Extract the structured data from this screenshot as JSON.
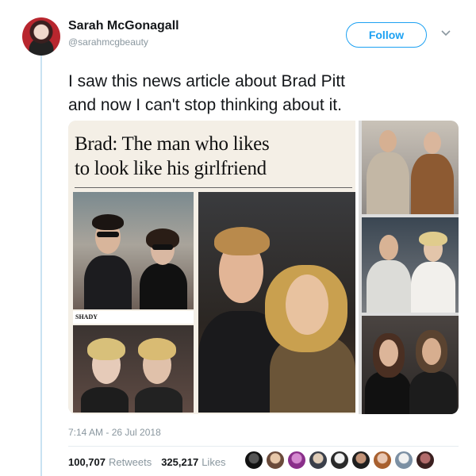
{
  "author": {
    "name": "Sarah McGonagall",
    "handle": "@sarahmcgbeauty"
  },
  "actions": {
    "follow_label": "Follow",
    "more_icon": "chevron-down-icon"
  },
  "tweet": {
    "line1": "I saw this news article about Brad Pitt",
    "line2": "and now I can't stop thinking about it."
  },
  "media": {
    "headline_line1": "Brad: The man who likes",
    "headline_line2": "to look like his girlfriend",
    "caption": "SHADY"
  },
  "meta": {
    "timestamp": "7:14 AM - 26 Jul 2018"
  },
  "stats": {
    "retweets": "100,707",
    "retweets_label": "Retweets",
    "likes": "325,217",
    "likes_label": "Likes"
  },
  "colors": {
    "accent": "#1da1f2",
    "muted": "#8a979f",
    "text": "#14171a"
  }
}
